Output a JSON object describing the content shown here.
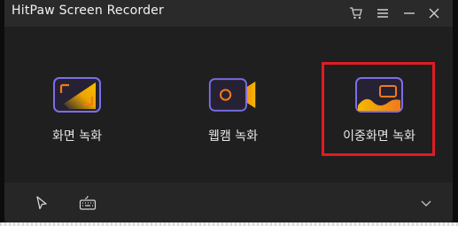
{
  "window": {
    "title": "HitPaw Screen Recorder"
  },
  "titlebar_icons": [
    "cart-icon",
    "menu-icon",
    "minimize-icon",
    "close-icon"
  ],
  "modes": [
    {
      "label": "화면 녹화",
      "icon": "screen-record-icon"
    },
    {
      "label": "웹캠 녹화",
      "icon": "webcam-record-icon"
    },
    {
      "label": "이중화면 녹화",
      "icon": "picture-in-picture-record-icon",
      "highlighted": true
    }
  ],
  "bottombar_icons": [
    "cursor-icon",
    "keyboard-icon",
    "chevron-down-icon"
  ],
  "colors": {
    "accent_purple": "#7b6fe8",
    "accent_orange": "#f07a1a",
    "accent_yellow": "#f5b800",
    "highlight_red": "#e01b24",
    "background": "#1f1f1f"
  }
}
